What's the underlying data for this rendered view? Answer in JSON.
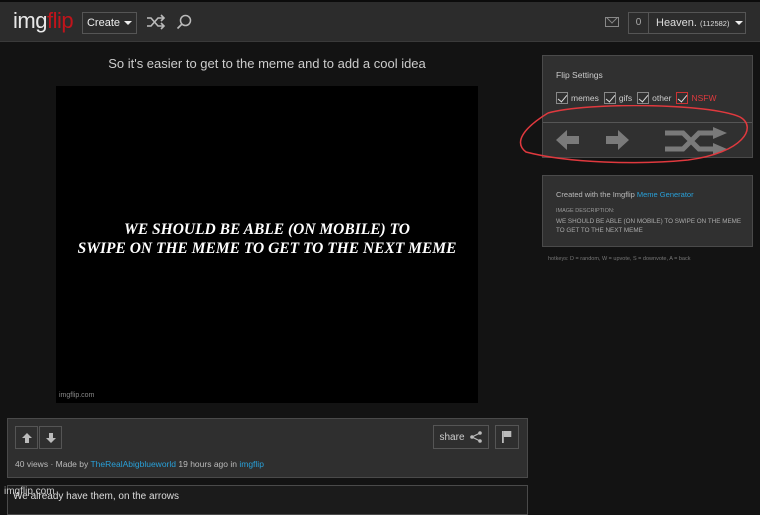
{
  "header": {
    "logo_part1": "img",
    "logo_part2": "flip",
    "create_label": "Create",
    "notification_count": "0",
    "username": "Heaven.",
    "user_points": "(112582)"
  },
  "post": {
    "title": "So it's easier to get to the meme and to add a cool idea",
    "meme_text_line1": "WE SHOULD BE ABLE (ON MOBILE) TO",
    "meme_text_line2": "SWIPE ON THE MEME TO GET TO THE NEXT MEME",
    "watermark": "imgflip.com",
    "share_label": "share",
    "views": "40 views",
    "made_by_prefix": "· Made by",
    "author": "TheRealAbigblueworld",
    "time_text": "19 hours ago in",
    "stream": "imgflip"
  },
  "comment": {
    "text": "We already have them, on the arrows",
    "overlay_watermark": "imgflip.com"
  },
  "flip_settings": {
    "title": "Flip Settings",
    "options": [
      {
        "label": "memes",
        "checked": true
      },
      {
        "label": "gifs",
        "checked": true
      },
      {
        "label": "other",
        "checked": true
      },
      {
        "label": "NSFW",
        "checked": true
      }
    ]
  },
  "info": {
    "created_prefix": "Created with the Imgflip",
    "generator_link": "Meme Generator",
    "description_label": "IMAGE DESCRIPTION:",
    "description": "WE SHOULD BE ABLE (ON MOBILE) TO SWIPE ON THE MEME TO GET TO THE NEXT MEME"
  },
  "hotkeys": "hotkeys: D = random, W = upvote, S = downvote, A = back",
  "colors": {
    "brand_red": "#c0141b",
    "link_blue": "#29a0d8",
    "annotation_red": "#e0393e"
  }
}
